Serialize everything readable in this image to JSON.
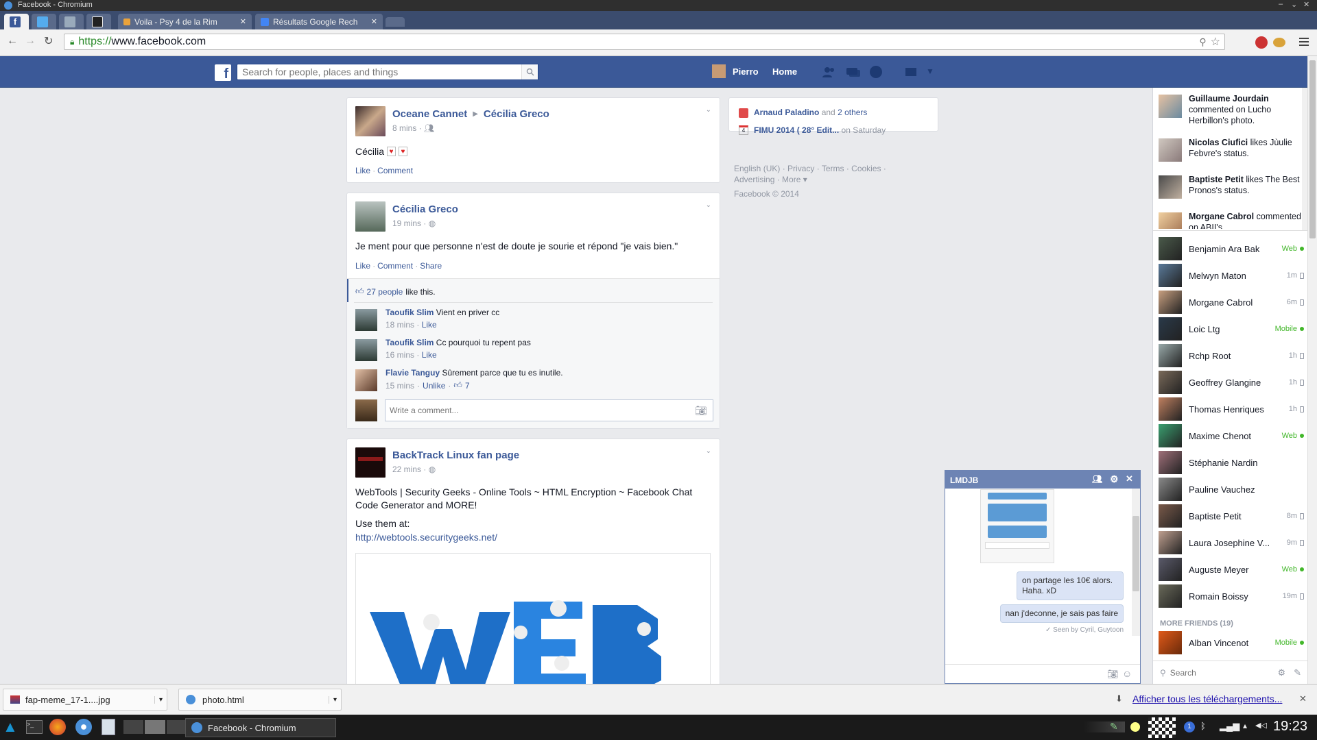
{
  "window": {
    "title": "Facebook - Chromium"
  },
  "tabs": [
    {
      "label": "",
      "icon": "facebook-icon",
      "active": true
    },
    {
      "label": "",
      "icon": "twitter-icon"
    },
    {
      "label": "",
      "icon": "app-icon"
    },
    {
      "label": "",
      "icon": "skull-icon"
    },
    {
      "label": "Voila - Psy 4 de la Rim",
      "icon": "music-icon"
    },
    {
      "label": "Résultats Google Rech",
      "icon": "google-icon"
    }
  ],
  "omnibox": {
    "protocol": "https://",
    "host": "www.facebook.com"
  },
  "fb_header": {
    "search_placeholder": "Search for people, places and things",
    "user_name": "Pierro",
    "home_label": "Home"
  },
  "posts": [
    {
      "author": "Oceane Cannet",
      "target": "Cécilia Greco",
      "time": "8 mins",
      "text": "Cécilia",
      "actions": [
        "Like",
        "Comment"
      ]
    },
    {
      "author": "Cécilia Greco",
      "time": "19 mins",
      "text": "Je ment pour que personne n'est de doute je sourie et répond \"je vais bien.\"",
      "actions": [
        "Like",
        "Comment",
        "Share"
      ],
      "likes_count": "27 people",
      "likes_suffix": "like this.",
      "comments": [
        {
          "author": "Taoufik Slim",
          "text": "Vient en priver cc",
          "time": "18 mins",
          "action": "Like"
        },
        {
          "author": "Taoufik Slim",
          "text": "Cc pourquoi tu repent pas",
          "time": "16 mins",
          "action": "Like"
        },
        {
          "author": "Flavie Tanguy",
          "text": "Sûrement parce que tu es inutile.",
          "time": "15 mins",
          "action": "Unlike",
          "likes": "7"
        }
      ],
      "comment_placeholder": "Write a comment..."
    },
    {
      "author": "BackTrack Linux fan page",
      "time": "22 mins",
      "text": "WebTools | Security Geeks - Online Tools ~ HTML Encryption ~ Facebook Chat Code Generator and MORE!",
      "text2": "Use them at:",
      "link": "http://webtools.securitygeeks.net/"
    }
  ],
  "right_column": {
    "birthday": {
      "name": "Arnaud Paladino",
      "mid": "and",
      "others": "2 others"
    },
    "event": {
      "day": "4",
      "name": "FIMU 2014 ( 28° Edit...",
      "when": "on Saturday"
    },
    "footer_links": [
      "English (UK)",
      "Privacy",
      "Terms",
      "Cookies",
      "Advertising",
      "More"
    ],
    "copyright": "Facebook © 2014"
  },
  "ticker": [
    {
      "name": "Guillaume Jourdain",
      "text": "commented on Lucho Herbillon's photo."
    },
    {
      "name": "Nicolas Ciufici",
      "text": "likes Jùulie Febvre's status."
    },
    {
      "name": "Baptiste Petit",
      "text": "likes The Best Pronos's status."
    },
    {
      "name": "Morgane Cabrol",
      "text": "commented on ABII's"
    }
  ],
  "friends": [
    {
      "name": "Benjamin Ara Bak",
      "status": "Web",
      "online": true
    },
    {
      "name": "Melwyn Maton",
      "status": "1m",
      "online": false
    },
    {
      "name": "Morgane Cabrol",
      "status": "6m",
      "online": false
    },
    {
      "name": "Loic Ltg",
      "status": "Mobile",
      "online": true
    },
    {
      "name": "Rchp Root",
      "status": "1h",
      "online": false
    },
    {
      "name": "Geoffrey Glangine",
      "status": "1h",
      "online": false
    },
    {
      "name": "Thomas Henriques",
      "status": "1h",
      "online": false
    },
    {
      "name": "Maxime Chenot",
      "status": "Web",
      "online": true
    },
    {
      "name": "Stéphanie Nardin",
      "status": "",
      "online": false
    },
    {
      "name": "Pauline Vauchez",
      "status": "",
      "online": false
    },
    {
      "name": "Baptiste Petit",
      "status": "8m",
      "online": false
    },
    {
      "name": "Laura Josephine V...",
      "status": "9m",
      "online": false
    },
    {
      "name": "Auguste Meyer",
      "status": "Web",
      "online": true
    },
    {
      "name": "Romain Boissy",
      "status": "19m",
      "online": false
    }
  ],
  "more_friends": {
    "label": "MORE FRIENDS (19)",
    "first": {
      "name": "Alban Vincenot",
      "status": "Mobile",
      "online": true
    }
  },
  "sidebar_search_placeholder": "Search",
  "chat": {
    "title": "LMDJB",
    "messages": [
      "on partage les 10€ alors. Haha. xD",
      "nan j'deconne, je sais pas faire"
    ],
    "seen": "Seen by Cyril, Guytoon"
  },
  "downloads": {
    "items": [
      "fap-meme_17-1....jpg",
      "photo.html"
    ],
    "show_all": "Afficher tous les téléchargements..."
  },
  "taskbar": {
    "window_label": "Facebook - Chromium",
    "clock": "19:23",
    "badge": "1"
  },
  "colors": {
    "fb_blue": "#3b5998",
    "online_green": "#42b72a"
  }
}
